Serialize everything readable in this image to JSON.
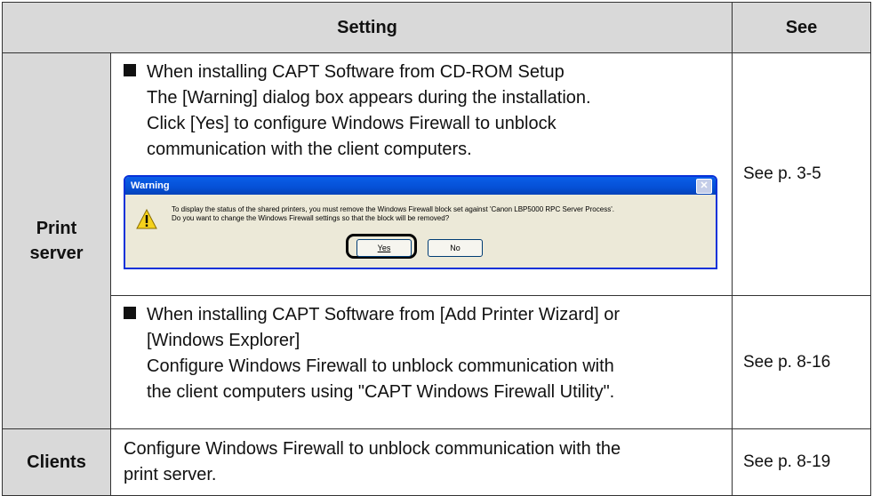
{
  "header": {
    "setting": "Setting",
    "see": "See"
  },
  "print_server": {
    "label_line1": "Print",
    "label_line2": "server",
    "row1": {
      "heading": "When installing CAPT Software from CD-ROM Setup",
      "body": [
        "The [Warning] dialog box appears during the installation.",
        "Click [Yes] to configure Windows Firewall to unblock",
        "communication with the client computers."
      ],
      "see": "See p. 3-5",
      "dialog": {
        "title": "Warning",
        "close": "✕",
        "message_line1": "To display the status of the shared printers, you must remove the Windows Firewall block set against 'Canon LBP5000 RPC Server Process'.",
        "message_line2": "Do you want to change the Windows Firewall settings so that the block will be removed?",
        "yes": "Yes",
        "no": "No"
      }
    },
    "row2": {
      "heading_line1": "When installing CAPT Software from [Add Printer Wizard] or",
      "heading_line2": "[Windows Explorer]",
      "body": [
        "Configure Windows Firewall to unblock communication with",
        "the client computers using \"CAPT Windows Firewall Utility\"."
      ],
      "see": "See p. 8-16"
    }
  },
  "clients": {
    "label": "Clients",
    "body_line1": "Configure Windows Firewall to unblock communication with the",
    "body_line2": "print server.",
    "see": "See p. 8-19"
  }
}
